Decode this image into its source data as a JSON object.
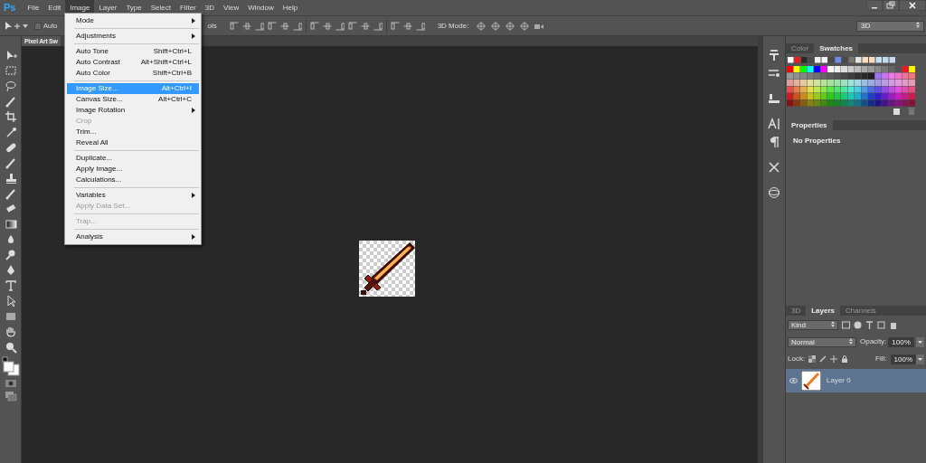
{
  "app_logo": "Ps",
  "menu_bar": [
    {
      "label": "File",
      "selected": false
    },
    {
      "label": "Edit",
      "selected": false
    },
    {
      "label": "Image",
      "selected": true
    },
    {
      "label": "Layer",
      "selected": false
    },
    {
      "label": "Type",
      "selected": false
    },
    {
      "label": "Select",
      "selected": false
    },
    {
      "label": "Filter",
      "selected": false
    },
    {
      "label": "3D",
      "selected": false
    },
    {
      "label": "View",
      "selected": false
    },
    {
      "label": "Window",
      "selected": false
    },
    {
      "label": "Help",
      "selected": false
    }
  ],
  "options_bar": {
    "auto_select": {
      "label": "Auto",
      "checked": false
    },
    "transform_label": "ols",
    "mode_label": "3D Mode:",
    "workspace": "3D"
  },
  "document_tab": {
    "title": "Pixel Art Sw"
  },
  "image_menu": [
    {
      "kind": "item",
      "label": "Mode",
      "submenu": true,
      "disabled": false,
      "selected": false
    },
    {
      "kind": "separator"
    },
    {
      "kind": "item",
      "label": "Adjustments",
      "submenu": true,
      "disabled": false,
      "selected": false
    },
    {
      "kind": "separator"
    },
    {
      "kind": "item",
      "label": "Auto Tone",
      "shortcut": "Shift+Ctrl+L",
      "submenu": false,
      "disabled": false,
      "selected": false
    },
    {
      "kind": "item",
      "label": "Auto Contrast",
      "shortcut": "Alt+Shift+Ctrl+L",
      "submenu": false,
      "disabled": false,
      "selected": false
    },
    {
      "kind": "item",
      "label": "Auto Color",
      "shortcut": "Shift+Ctrl+B",
      "submenu": false,
      "disabled": false,
      "selected": false
    },
    {
      "kind": "separator"
    },
    {
      "kind": "item",
      "label": "Image Size...",
      "shortcut": "Alt+Ctrl+I",
      "submenu": false,
      "disabled": false,
      "selected": true
    },
    {
      "kind": "item",
      "label": "Canvas Size...",
      "shortcut": "Alt+Ctrl+C",
      "submenu": false,
      "disabled": false,
      "selected": false
    },
    {
      "kind": "item",
      "label": "Image Rotation",
      "submenu": true,
      "disabled": false,
      "selected": false
    },
    {
      "kind": "item",
      "label": "Crop",
      "submenu": false,
      "disabled": true,
      "selected": false
    },
    {
      "kind": "item",
      "label": "Trim...",
      "submenu": false,
      "disabled": false,
      "selected": false
    },
    {
      "kind": "item",
      "label": "Reveal All",
      "submenu": false,
      "disabled": false,
      "selected": false
    },
    {
      "kind": "separator"
    },
    {
      "kind": "item",
      "label": "Duplicate...",
      "submenu": false,
      "disabled": false,
      "selected": false
    },
    {
      "kind": "item",
      "label": "Apply Image...",
      "submenu": false,
      "disabled": false,
      "selected": false
    },
    {
      "kind": "item",
      "label": "Calculations...",
      "submenu": false,
      "disabled": false,
      "selected": false
    },
    {
      "kind": "separator"
    },
    {
      "kind": "item",
      "label": "Variables",
      "submenu": true,
      "disabled": false,
      "selected": false
    },
    {
      "kind": "item",
      "label": "Apply Data Set...",
      "submenu": false,
      "disabled": true,
      "selected": false
    },
    {
      "kind": "separator"
    },
    {
      "kind": "item",
      "label": "Trap...",
      "submenu": false,
      "disabled": true,
      "selected": false
    },
    {
      "kind": "separator"
    },
    {
      "kind": "item",
      "label": "Analysis",
      "submenu": true,
      "disabled": false,
      "selected": false
    }
  ],
  "color_panel": {
    "tabs": [
      {
        "label": "Color",
        "selected": false
      },
      {
        "label": "Swatches",
        "selected": true
      }
    ]
  },
  "properties_panel": {
    "title": "Properties",
    "message": "No Properties"
  },
  "layers_panel": {
    "tabs": [
      {
        "label": "3D",
        "selected": false
      },
      {
        "label": "Layers",
        "selected": true
      },
      {
        "label": "Channels",
        "selected": false
      }
    ],
    "filter": "Kind",
    "blend_mode": "Normal",
    "opacity_label": "Opacity:",
    "opacity": "100%",
    "lock_label": "Lock:",
    "fill_label": "Fill:",
    "fill": "100%",
    "layers": [
      {
        "name": "Layer 0",
        "visible": true,
        "selected": true
      }
    ]
  }
}
